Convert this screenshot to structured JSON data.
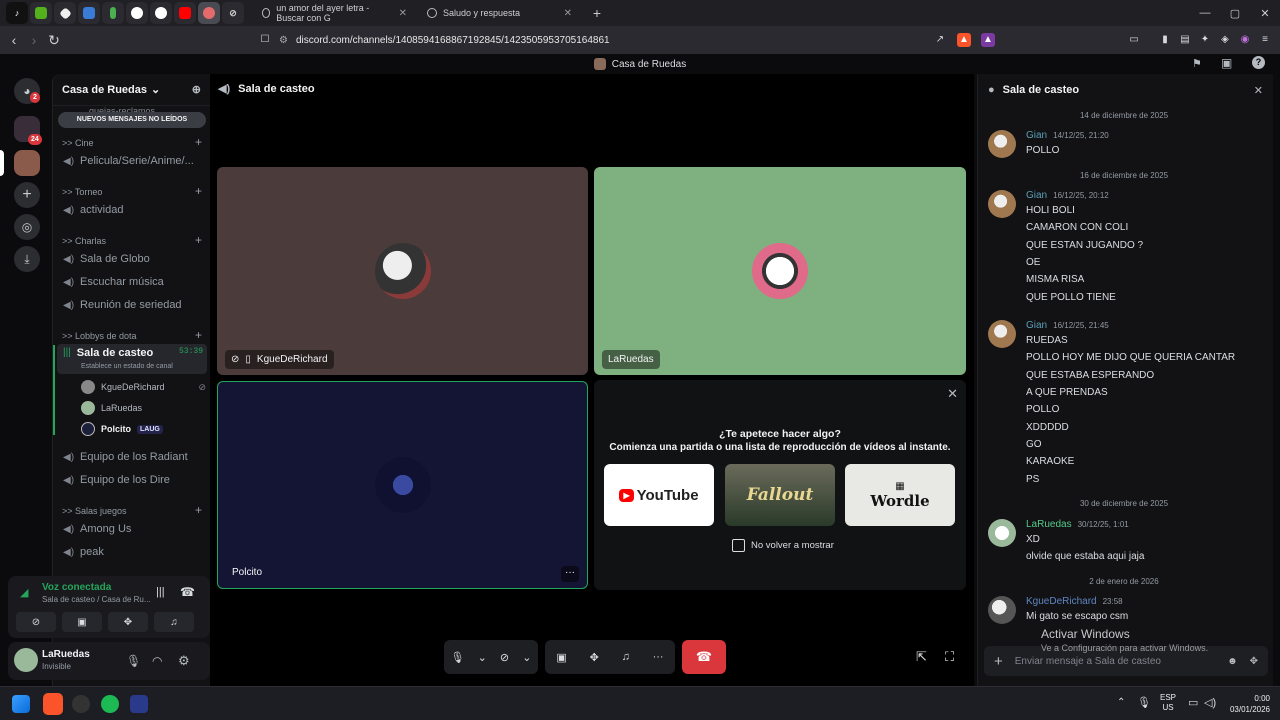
{
  "browser": {
    "tabs": [
      {
        "title": "un amor del ayer letra - Buscar con G"
      },
      {
        "title": "Saludo y respuesta"
      }
    ],
    "url": "discord.com/channels/1408594168867192845/1423505953705164861",
    "new_tab": "+",
    "window_controls": [
      "—",
      "▢",
      "✕"
    ]
  },
  "discord": {
    "window_title": "Casa de Ruedas",
    "rail": {
      "dm_badge": "2",
      "server_badge": "24"
    },
    "server": {
      "name": "Casa de Ruedas"
    },
    "top_partial_channel": "quejas-reclamos",
    "new_messages_banner": "NUEVOS MENSAJES NO LEÍDOS",
    "categories": [
      {
        "label": ">> Cine",
        "channels": [
          "Pelicula/Serie/Anime/..."
        ]
      },
      {
        "label": ">> Torneo",
        "channels": [
          "actividad"
        ]
      },
      {
        "label": ">> Charlas",
        "channels": [
          "Sala de Globo",
          "Escuchar música",
          "Reunión de seriedad"
        ]
      },
      {
        "label": ">> Lobbys de dota",
        "channels": [
          "Sala de casteo",
          "Equipo de los Radiant",
          "Equipo de los Dire"
        ]
      },
      {
        "label": ">> Salas juegos",
        "channels": [
          "Among Us",
          "peak"
        ]
      }
    ],
    "active_channel": {
      "name": "Sala de casteo",
      "timer": "53:39",
      "status_hint": "Establece un estado de canal",
      "users": [
        {
          "name": "KgueDeRichard"
        },
        {
          "name": "LaRuedas"
        },
        {
          "name": "Polcito",
          "tag": "LAUG"
        }
      ]
    },
    "voice_panel": {
      "status": "Voz conectada",
      "location": "Sala de casteo / Casa de Ru..."
    },
    "user_panel": {
      "name": "LaRuedas",
      "status": "Invisible"
    },
    "call": {
      "title": "Sala de casteo",
      "tiles": [
        {
          "name": "KgueDeRichard"
        },
        {
          "name": "LaRuedas"
        },
        {
          "name": "Polcito"
        }
      ],
      "activity_prompt": {
        "title": "¿Te apetece hacer algo?",
        "subtitle": "Comienza una partida o una lista de reproducción de vídeos al instante.",
        "apps": [
          "YouTube",
          "Fallout",
          "Wordle"
        ],
        "checkbox_label": "No volver a mostrar",
        "checkbox_checked": false
      },
      "more": "···"
    },
    "chat": {
      "title": "Sala de casteo",
      "dates": [
        "14 de diciembre de 2025",
        "16 de diciembre de 2025",
        "30 de diciembre de 2025",
        "2 de enero de 2026"
      ],
      "messages": [
        {
          "author": "Gian",
          "time": "14/12/25, 21:20",
          "lines": [
            "POLLO"
          ]
        },
        {
          "author": "Gian",
          "time": "16/12/25, 20:12",
          "lines": [
            "HOLI BOLI",
            "CAMARON CON COLI",
            "QUE ESTAN JUGANDO ?",
            "OE",
            "MISMA RISA",
            "QUE POLLO TIENE"
          ]
        },
        {
          "author": "Gian",
          "time": "16/12/25, 21:45",
          "lines": [
            "RUEDAS",
            "POLLO HOY ME DIJO QUE QUERIA CANTAR",
            "QUE ESTABA ESPERANDO",
            "A QUE PRENDAS",
            "POLLO",
            "XDDDDD",
            "GO",
            "KARAOKE",
            "PS"
          ]
        },
        {
          "author": "LaRuedas",
          "time": "30/12/25, 1:01",
          "lines": [
            "XD",
            "olvide que estaba aqui jaja"
          ]
        },
        {
          "author": "KgueDeRichard",
          "time": "23:58",
          "lines": [
            "Mi gato se escapo csm"
          ]
        }
      ],
      "input_placeholder": "Enviar mensaje a Sala de casteo"
    },
    "colors": {
      "accent_green": "#23a55a",
      "hangup_red": "#da373c",
      "author_gian": "#5a9fb8",
      "author_laruedas": "#57c98a",
      "author_kgue": "#5f86c4"
    }
  },
  "windows": {
    "activation_title": "Activar Windows",
    "activation_sub": "Ve a Configuración para activar Windows.",
    "lang": "ESP",
    "layout": "US",
    "time": "0:00",
    "date": "03/01/2026"
  }
}
